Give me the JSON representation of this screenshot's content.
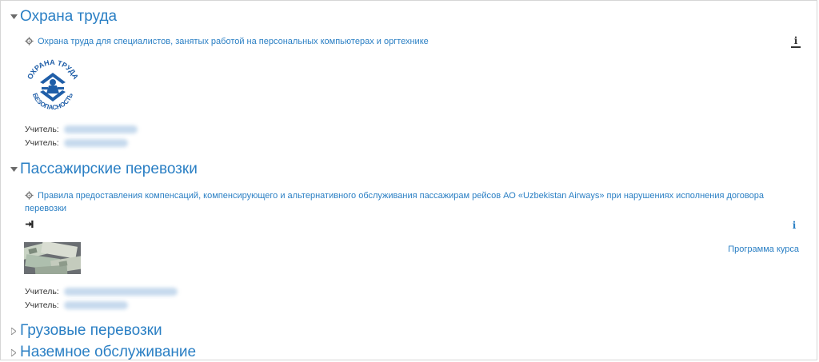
{
  "categories": [
    {
      "title": "Охрана труда",
      "expanded": true,
      "course": {
        "name": "Охрана труда для специалистов, занятых работой на персональных компьютерах и оргтехнике",
        "logo_text_top": "ОХРАНА ТРУДА",
        "logo_text_bottom": "БЕЗОПАСНОСТЬ",
        "teacher_label": "Учитель:"
      }
    },
    {
      "title": "Пассажирские перевозки",
      "expanded": true,
      "course": {
        "name_line1": "Правила предоставления компенсаций, компенсирующего и альтернативного обслуживания пассажирам рейсов АО «Uzbekistan Airways» при нарушениях исполнения договора",
        "name_line2": "перевозки",
        "teacher_label": "Учитель:",
        "syllabus_link": "Программа курса"
      }
    },
    {
      "title": "Грузовые перевозки",
      "expanded": false
    },
    {
      "title": "Наземное обслуживание",
      "expanded": false
    }
  ],
  "icons": {
    "expanded_toggle": "caret-down-icon",
    "collapsed_toggle": "caret-right-icon",
    "course_icon": "gear-icon",
    "info_icon": "info-icon",
    "enrol_icon": "sign-in-icon"
  },
  "colors": {
    "link": "#2a7fc4",
    "text": "#333333",
    "logo_blue": "#1f5ea8"
  }
}
